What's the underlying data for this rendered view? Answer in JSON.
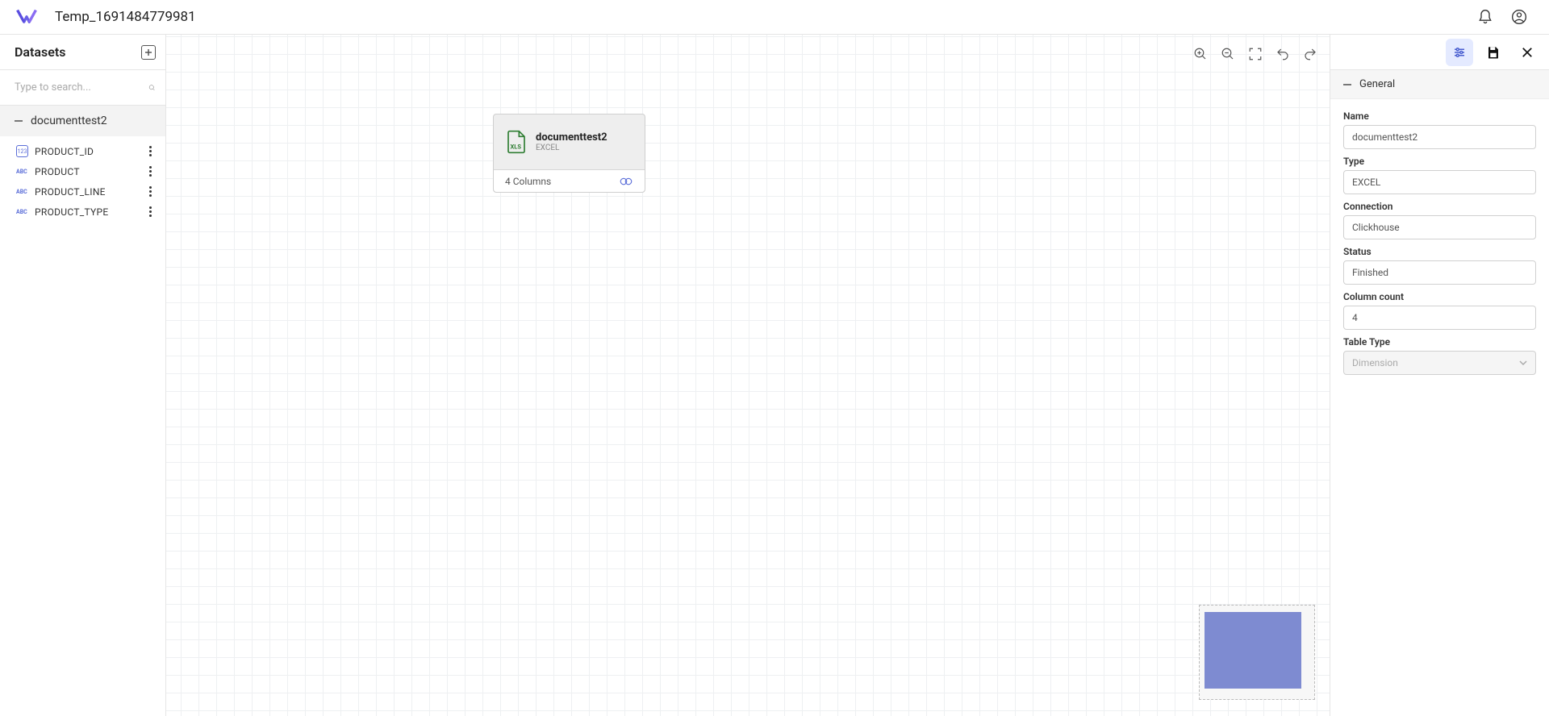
{
  "header": {
    "page_title": "Temp_1691484779981"
  },
  "sidebar": {
    "title": "Datasets",
    "search_placeholder": "Type to search...",
    "dataset_name": "documenttest2",
    "columns": [
      {
        "name": "PRODUCT_ID",
        "type": "id"
      },
      {
        "name": "PRODUCT",
        "type": "abc"
      },
      {
        "name": "PRODUCT_LINE",
        "type": "abc"
      },
      {
        "name": "PRODUCT_TYPE",
        "type": "abc"
      }
    ]
  },
  "canvas": {
    "node": {
      "title": "documenttest2",
      "subtitle": "EXCEL",
      "footer": "4 Columns"
    }
  },
  "rpanel": {
    "section": "General",
    "fields": {
      "name_label": "Name",
      "name_value": "documenttest2",
      "type_label": "Type",
      "type_value": "EXCEL",
      "conn_label": "Connection",
      "conn_value": "Clickhouse",
      "status_label": "Status",
      "status_value": "Finished",
      "colcount_label": "Column count",
      "colcount_value": "4",
      "tabletype_label": "Table Type",
      "tabletype_value": "Dimension"
    }
  }
}
